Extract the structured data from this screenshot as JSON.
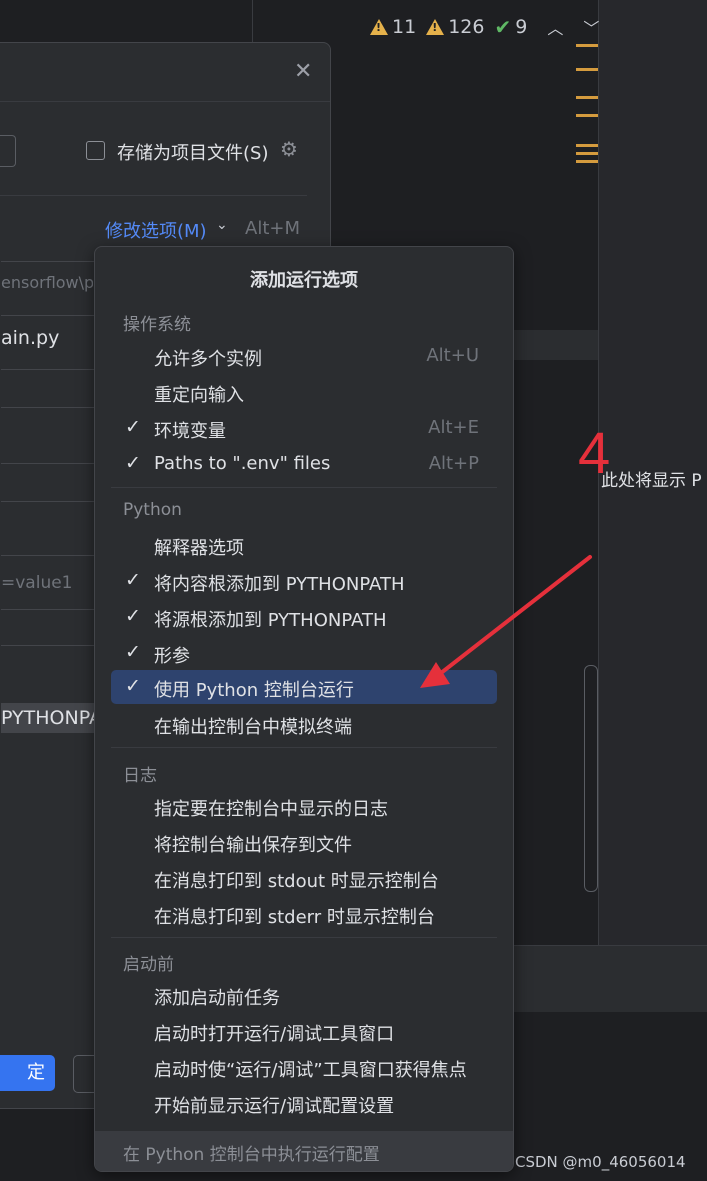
{
  "inspection": {
    "warnings": "11",
    "weak_warnings": "126",
    "typos": "9"
  },
  "right_panel_hint": "此处将显示 P",
  "annotation_number": "4",
  "watermark": "CSDN @m0_46056014",
  "dialog": {
    "store_as_project_file": "存储为项目文件(S)",
    "modify_options": "修改选项(M)",
    "modify_shortcut": "Alt+M",
    "path_fragment": "ensorflow\\py",
    "script_fragment": "ain.py",
    "env_placeholder_fragment": "=value1",
    "pythonpath_fragment": "PYTHONPA",
    "ok_fragment": "定"
  },
  "popup": {
    "title": "添加运行选项",
    "sections": [
      {
        "name": "操作系统",
        "items": [
          {
            "label": "允许多个实例",
            "checked": false,
            "shortcut": "Alt+U"
          },
          {
            "label": "重定向输入",
            "checked": false,
            "shortcut": ""
          },
          {
            "label": "环境变量",
            "checked": true,
            "shortcut": "Alt+E"
          },
          {
            "label": "Paths to \".env\" files",
            "checked": true,
            "shortcut": "Alt+P"
          }
        ]
      },
      {
        "name": "Python",
        "items": [
          {
            "label": "解释器选项",
            "checked": false,
            "shortcut": ""
          },
          {
            "label": "将内容根添加到 PYTHONPATH",
            "checked": true,
            "shortcut": ""
          },
          {
            "label": "将源根添加到 PYTHONPATH",
            "checked": true,
            "shortcut": ""
          },
          {
            "label": "形参",
            "checked": true,
            "shortcut": ""
          },
          {
            "label": "使用 Python 控制台运行",
            "checked": true,
            "shortcut": "",
            "selected": true
          },
          {
            "label": "在输出控制台中模拟终端",
            "checked": false,
            "shortcut": ""
          }
        ]
      },
      {
        "name": "日志",
        "items": [
          {
            "label": "指定要在控制台中显示的日志",
            "checked": false,
            "shortcut": ""
          },
          {
            "label": "将控制台输出保存到文件",
            "checked": false,
            "shortcut": ""
          },
          {
            "label": "在消息打印到 stdout 时显示控制台",
            "checked": false,
            "shortcut": ""
          },
          {
            "label": "在消息打印到 stderr 时显示控制台",
            "checked": false,
            "shortcut": ""
          }
        ]
      },
      {
        "name": "启动前",
        "items": [
          {
            "label": "添加启动前任务",
            "checked": false,
            "shortcut": ""
          },
          {
            "label": "启动时打开运行/调试工具窗口",
            "checked": false,
            "shortcut": ""
          },
          {
            "label": "启动时使“运行/调试”工具窗口获得焦点",
            "checked": false,
            "shortcut": ""
          },
          {
            "label": "开始前显示运行/调试配置设置",
            "checked": false,
            "shortcut": ""
          }
        ]
      }
    ],
    "footer": "在 Python 控制台中执行运行配置"
  },
  "colors": {
    "accent": "#3574f0",
    "link": "#548af7",
    "selection": "#2e436e",
    "annotation": "#e5303b",
    "warning": "#e5b14b"
  }
}
